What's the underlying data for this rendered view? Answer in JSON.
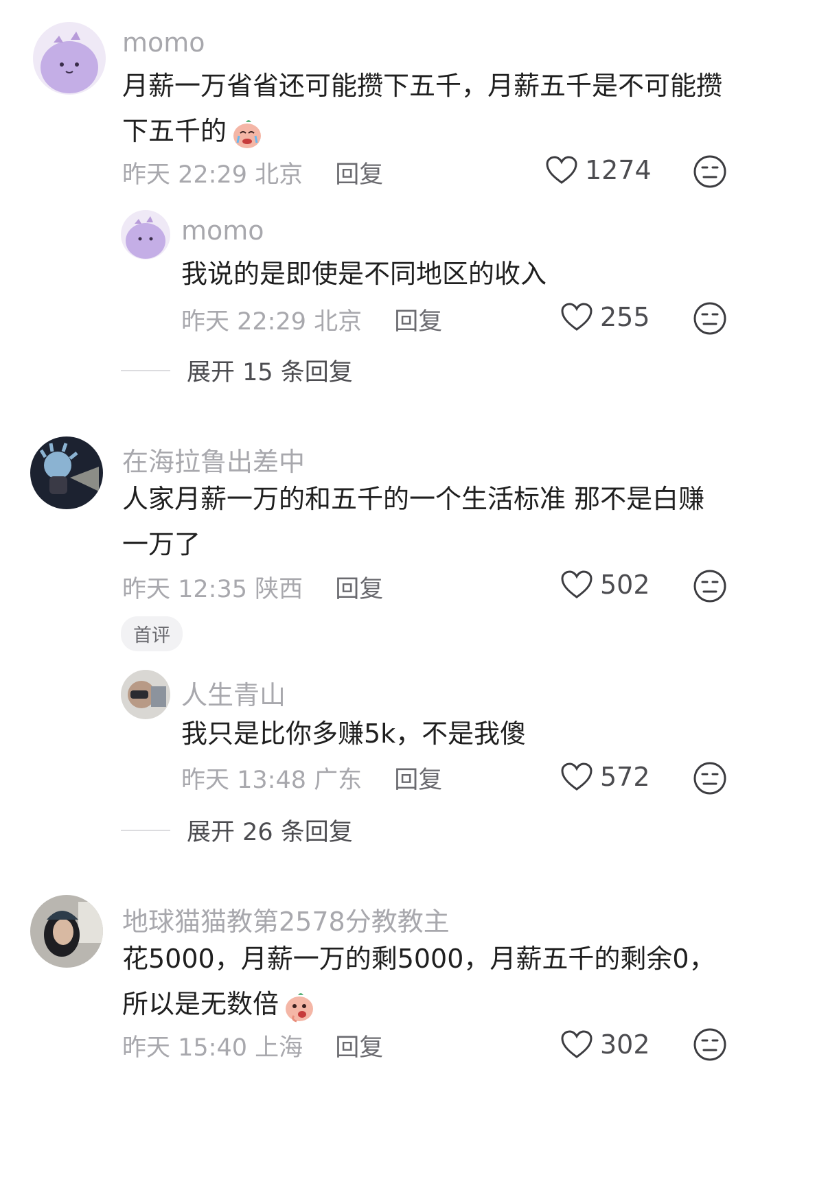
{
  "comments": [
    {
      "username": "momo",
      "text": "月薪一万省省还可能攒下五千，月薪五千是不可能攒下五千的",
      "time": "昨天 22:29",
      "location": "北京",
      "reply": "回复",
      "likes": "1274"
    },
    {
      "username": "momo",
      "text": "我说的是即使是不同地区的收入",
      "time": "昨天 22:29",
      "location": "北京",
      "reply": "回复",
      "likes": "255",
      "expand": "展开 15 条回复"
    },
    {
      "username": "在海拉鲁出差中",
      "text_line1": "人家月薪一万的和五千的一个生活标准 那不是白赚",
      "text_line2": "一万了",
      "time": "昨天 12:35",
      "location": "陕西",
      "reply": "回复",
      "likes": "502",
      "tag": "首评"
    },
    {
      "username": "人生青山",
      "text": "我只是比你多赚5k，不是我傻",
      "time": "昨天 13:48",
      "location": "广东",
      "reply": "回复",
      "likes": "572",
      "expand": "展开 26 条回复"
    },
    {
      "username": "地球猫猫教第2578分教教主",
      "text_line1": "花5000，月薪一万的剩5000，月薪五千的剩余0，",
      "text_line2": "所以是无数倍",
      "time": "昨天 15:40",
      "location": "上海",
      "reply": "回复",
      "likes": "302"
    }
  ],
  "icons": {
    "like": "heart-outline-icon",
    "dislike": "meh-face-icon",
    "emoji_cry": "crying-face-emoji",
    "emoji_tease": "teasing-face-emoji"
  },
  "colors": {
    "username": "#a8a8ad",
    "text": "#1f1f1f",
    "meta": "#a8a8ad",
    "count": "#4c4c50"
  }
}
